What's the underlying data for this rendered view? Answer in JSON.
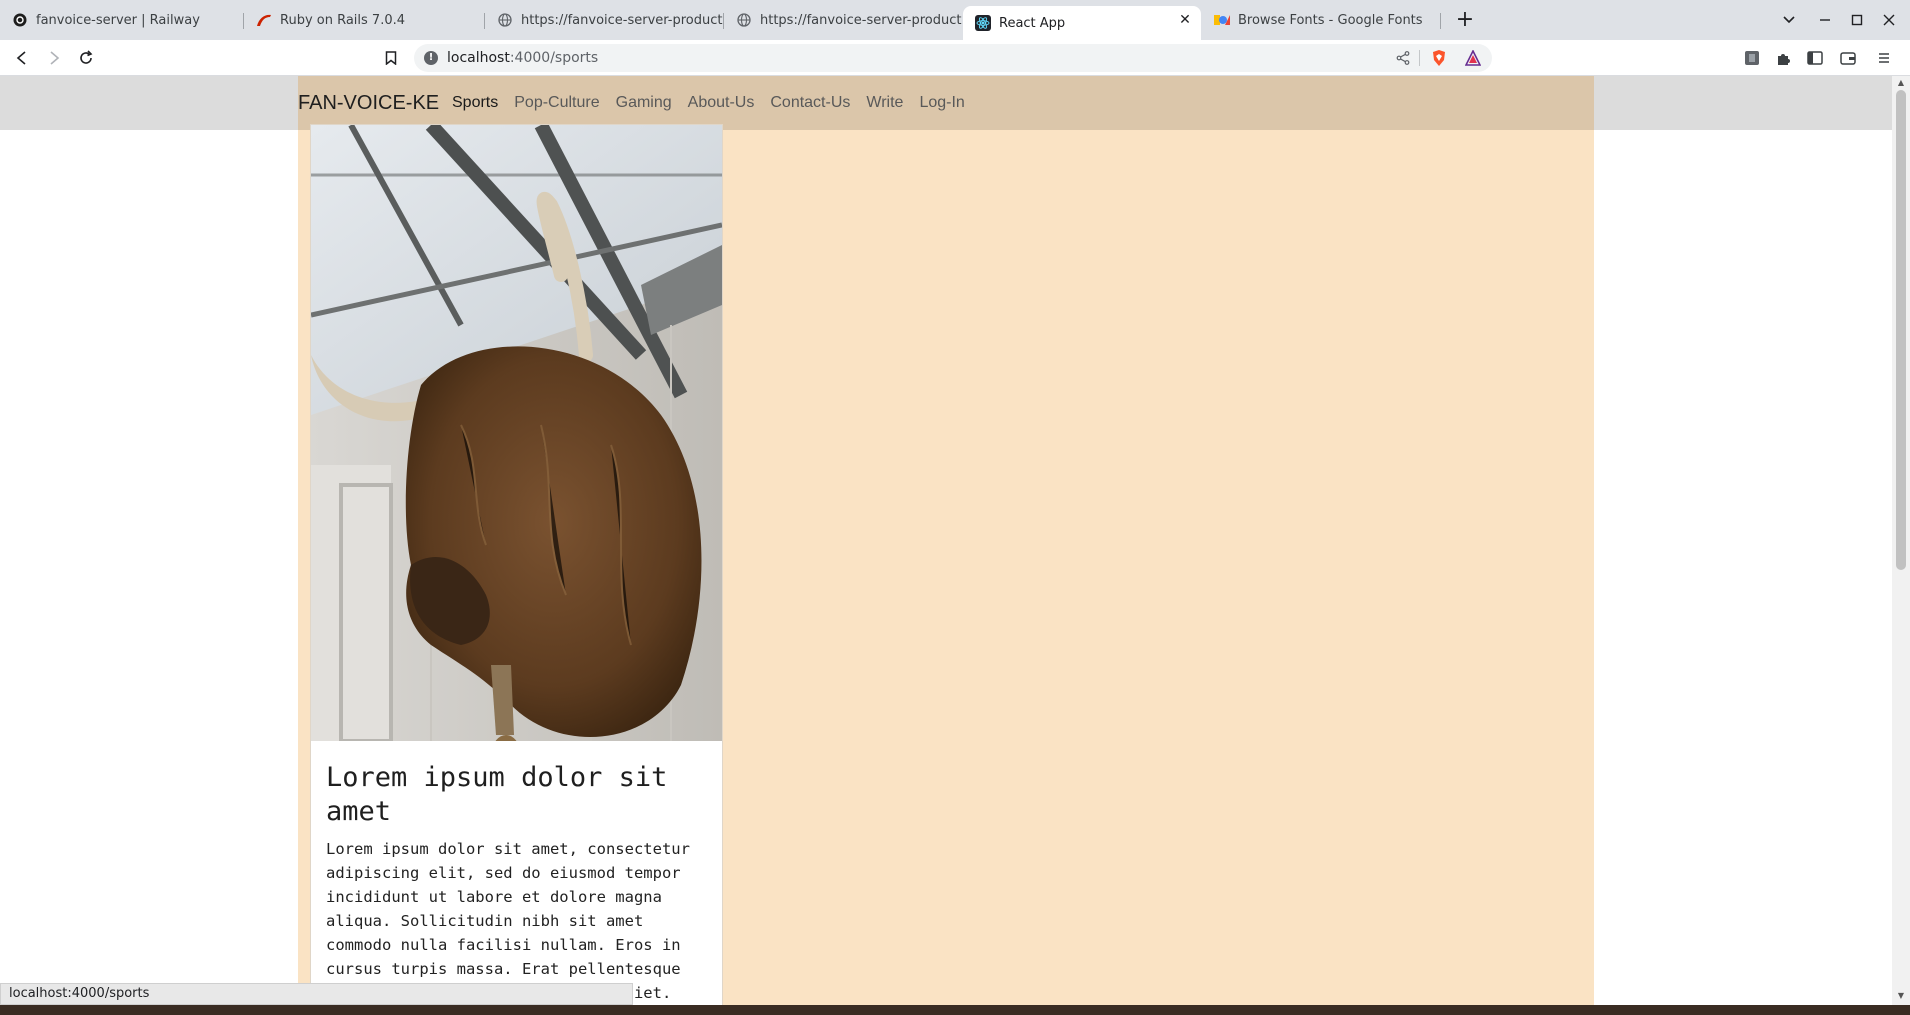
{
  "browser": {
    "tabs": [
      {
        "title": "fanvoice-server | Railway",
        "favicon": "railway-icon",
        "active": false
      },
      {
        "title": "Ruby on Rails 7.0.4",
        "favicon": "rails-icon",
        "active": false
      },
      {
        "title": "https://fanvoice-server-productio",
        "favicon": "globe-icon",
        "active": false
      },
      {
        "title": "https://fanvoice-server-productio",
        "favicon": "globe-icon",
        "active": false
      },
      {
        "title": "React App",
        "favicon": "react-icon",
        "active": true
      },
      {
        "title": "Browse Fonts - Google Fonts",
        "favicon": "google-fonts-icon",
        "active": false
      }
    ],
    "address": {
      "host": "localhost",
      "rest": ":4000/sports"
    },
    "status_url": "localhost:4000/sports"
  },
  "site": {
    "brand": "FAN-VOICE-KE",
    "nav": [
      {
        "label": "Sports",
        "active": true
      },
      {
        "label": "Pop-Culture",
        "active": false
      },
      {
        "label": "Gaming",
        "active": false
      },
      {
        "label": "About-Us",
        "active": false
      },
      {
        "label": "Contact-Us",
        "active": false
      },
      {
        "label": "Write",
        "active": false
      },
      {
        "label": "Log-In",
        "active": false
      }
    ],
    "card": {
      "image": "highland-cow-head-photo",
      "title": "Lorem ipsum dolor sit amet",
      "text": "Lorem ipsum dolor sit amet, consectetur adipiscing elit, sed do eiusmod tempor incididunt ut labore et dolore magna aliqua. Sollicitudin nibh sit amet commodo nulla facilisi nullam. Eros in cursus turpis massa. Erat pellentesque adipiscing commodo elit at imperdiet."
    }
  },
  "colors": {
    "page_bg": "#fae3c4",
    "navbar_bg": "#dbc6aa",
    "brand_text": "#1f1f1f"
  }
}
